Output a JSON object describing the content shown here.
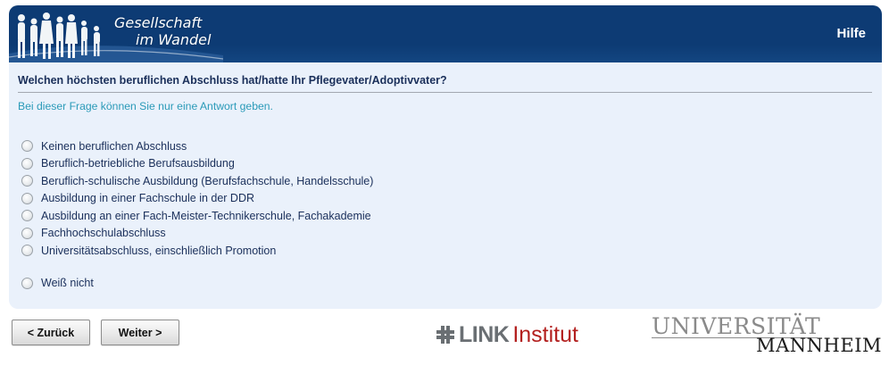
{
  "header": {
    "logo_line1": "Gesellschaft",
    "logo_line2": "im Wandel",
    "help_label": "Hilfe"
  },
  "question": {
    "title": "Welchen höchsten beruflichen Abschluss hat/hatte Ihr Pflegevater/Adoptivvater?",
    "hint": "Bei dieser Frage können Sie nur eine Antwort geben.",
    "options": [
      "Keinen beruflichen Abschluss",
      "Beruflich-betriebliche Berufsausbildung",
      "Beruflich-schulische Ausbildung (Berufsfachschule, Handelsschule)",
      "Ausbildung in einer Fachschule in der DDR",
      "Ausbildung an einer Fach-Meister-Technikerschule, Fachakademie",
      "Fachhochschulabschluss",
      "Universitätsabschluss, einschließlich Promotion"
    ],
    "extra_option": "Weiß nicht"
  },
  "navigation": {
    "back_label": "< Zurück",
    "next_label": "Weiter >"
  },
  "logos": {
    "link_word": "LINK",
    "institut_word": "Institut",
    "uni_line1": "UNIVERSITÄT",
    "uni_line2": "MANNHEIM"
  },
  "colors": {
    "header_bg": "#0d3b74",
    "panel_bg": "#eaf1fb",
    "question_text": "#1a2f5a",
    "hint_text": "#2a9ab8",
    "link_red": "#b3201f"
  }
}
